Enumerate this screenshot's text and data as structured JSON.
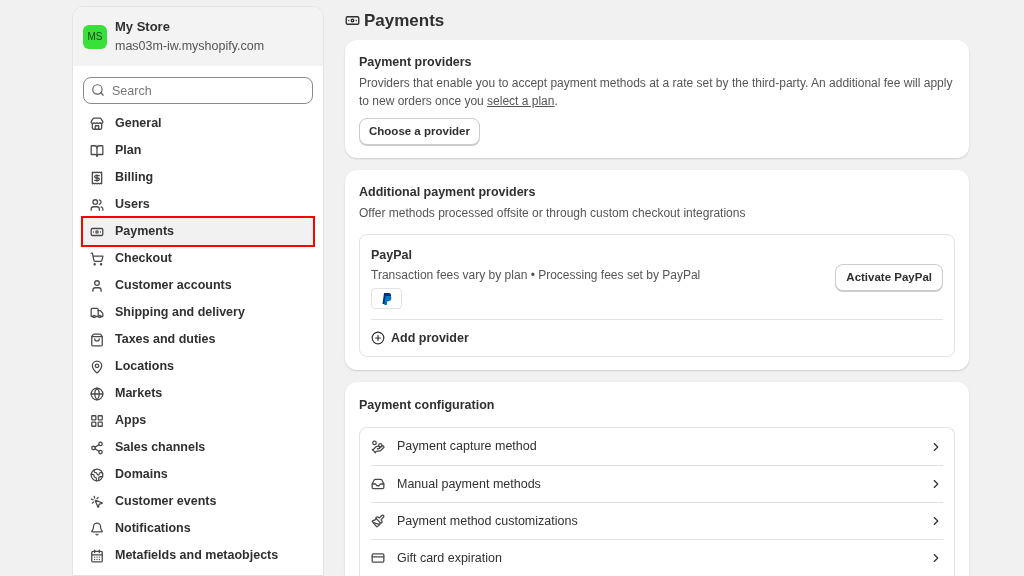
{
  "store": {
    "initials": "MS",
    "name": "My Store",
    "domain": "mas03m-iw.myshopify.com"
  },
  "search": {
    "placeholder": "Search"
  },
  "sidebar": {
    "items": [
      {
        "label": "General",
        "selected": false,
        "highlighted": false
      },
      {
        "label": "Plan",
        "selected": false,
        "highlighted": false
      },
      {
        "label": "Billing",
        "selected": false,
        "highlighted": false
      },
      {
        "label": "Users",
        "selected": false,
        "highlighted": false
      },
      {
        "label": "Payments",
        "selected": true,
        "highlighted": true
      },
      {
        "label": "Checkout",
        "selected": false,
        "highlighted": false
      },
      {
        "label": "Customer accounts",
        "selected": false,
        "highlighted": false
      },
      {
        "label": "Shipping and delivery",
        "selected": false,
        "highlighted": false
      },
      {
        "label": "Taxes and duties",
        "selected": false,
        "highlighted": false
      },
      {
        "label": "Locations",
        "selected": false,
        "highlighted": false
      },
      {
        "label": "Markets",
        "selected": false,
        "highlighted": false
      },
      {
        "label": "Apps",
        "selected": false,
        "highlighted": false
      },
      {
        "label": "Sales channels",
        "selected": false,
        "highlighted": false
      },
      {
        "label": "Domains",
        "selected": false,
        "highlighted": false
      },
      {
        "label": "Customer events",
        "selected": false,
        "highlighted": false
      },
      {
        "label": "Notifications",
        "selected": false,
        "highlighted": false
      },
      {
        "label": "Metafields and metaobjects",
        "selected": false,
        "highlighted": false
      }
    ]
  },
  "page": {
    "title": "Payments",
    "providers": {
      "title": "Payment providers",
      "text": "Providers that enable you to accept payment methods at a rate set by the third-party. An additional fee will apply to new orders once you",
      "link": "select a plan",
      "after": ".",
      "button": "Choose a provider"
    },
    "additional": {
      "title": "Additional payment providers",
      "subtitle": "Offer methods processed offsite or through custom checkout integrations",
      "provider": {
        "name": "PayPal",
        "text": "Transaction fees vary by plan • Processing fees set by PayPal",
        "button": "Activate PayPal"
      },
      "add": "Add provider"
    },
    "config": {
      "title": "Payment configuration",
      "rows": [
        {
          "label": "Payment capture method"
        },
        {
          "label": "Manual payment methods"
        },
        {
          "label": "Payment method customizations"
        },
        {
          "label": "Gift card expiration"
        }
      ]
    }
  }
}
